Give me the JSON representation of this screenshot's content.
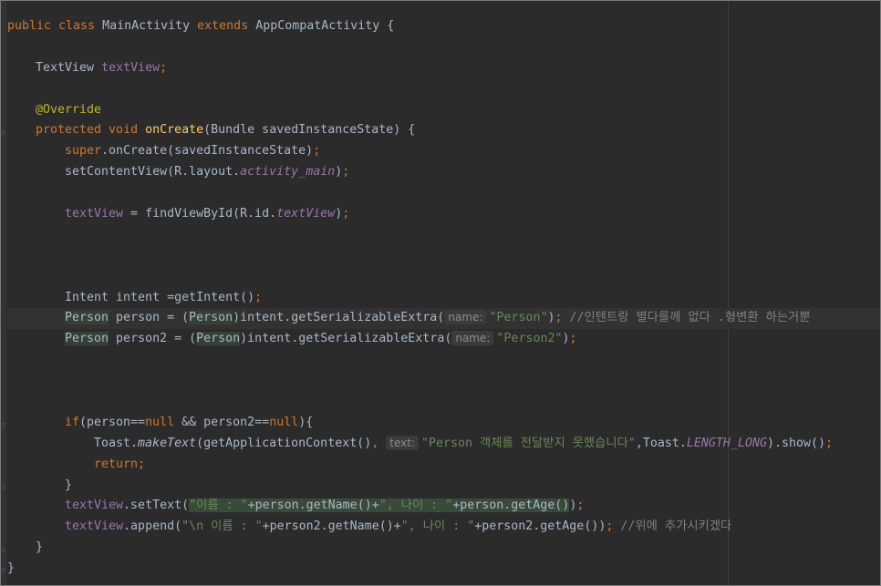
{
  "code": {
    "l1": {
      "kw1": "public class ",
      "cls": "MainActivity ",
      "kw2": "extends ",
      "base": "AppCompatActivity {"
    },
    "l2": {
      "type": "TextView ",
      "field": "textView",
      "semi": ";"
    },
    "l3": {
      "ann": "@Override"
    },
    "l4": {
      "kw": "protected void ",
      "fn": "onCreate",
      "rest": "(Bundle savedInstanceState) {"
    },
    "l5": {
      "kw": "super",
      "rest": ".onCreate(savedInstanceState)",
      "semi": ";"
    },
    "l6": {
      "pre": "setContentView(R.layout.",
      "ital": "activity_main",
      "post": ")",
      "semi": ";"
    },
    "l7": {
      "field": "textView",
      "pre": " = findViewById(R.id.",
      "ital": "textView",
      "post": ")",
      "semi": ";"
    },
    "l8": {
      "text": "Intent intent =getIntent()",
      "semi": ";"
    },
    "l9": {
      "type": "Person",
      "mid": " person = (",
      "cast": "Person",
      "call": ")intent.getSerializableExtra(",
      "hint": "name:",
      "str": "\"Person\"",
      "close": ")",
      "semi": ";",
      "cmt": " //인텐트랑 별다를께 없다 .형변환 하는거뿐"
    },
    "l10": {
      "type": "Person",
      "mid": " person2 = (",
      "cast": "Person",
      "call": ")intent.getSerializableExtra(",
      "hint": "name:",
      "str": "\"Person2\"",
      "close": ")",
      "semi": ";"
    },
    "l11": {
      "kw1": "if",
      "p1": "(person==",
      "kw2": "null",
      "p2": " && person2==",
      "kw3": "null",
      "p3": "){"
    },
    "l12": {
      "pre": "Toast.",
      "ital": "makeText",
      "call": "(getApplicationContext()",
      "comma": ",",
      "hint": "text:",
      "str": "\"Person 객체를 전달받지 못했습니다\"",
      "mid": ",Toast.",
      "const": "LENGTH_LONG",
      "post": ").show()",
      "semi": ";"
    },
    "l13": {
      "kw": "return",
      "semi": ";"
    },
    "l14": {
      "brace": "}"
    },
    "l15": {
      "field": "textView",
      "call": ".setText(",
      "str1": "\"이름 : \"",
      "plus1": "+person.getName()+",
      "str2": "\", 나이 : \"",
      "plus2": "+person.getAge()",
      "close": ")",
      "semi": ";"
    },
    "l16": {
      "field": "textView",
      "call": ".append(",
      "str1": "\"\\n 이름 : \"",
      "plus1": "+person2.getName()+",
      "str2": "\", 나이 : \"",
      "plus2": "+person2.getAge())",
      "semi": ";",
      "cmt": " //위에 추가시키겠다"
    },
    "l17": {
      "brace": "}"
    },
    "l18": {
      "brace": "}"
    }
  }
}
